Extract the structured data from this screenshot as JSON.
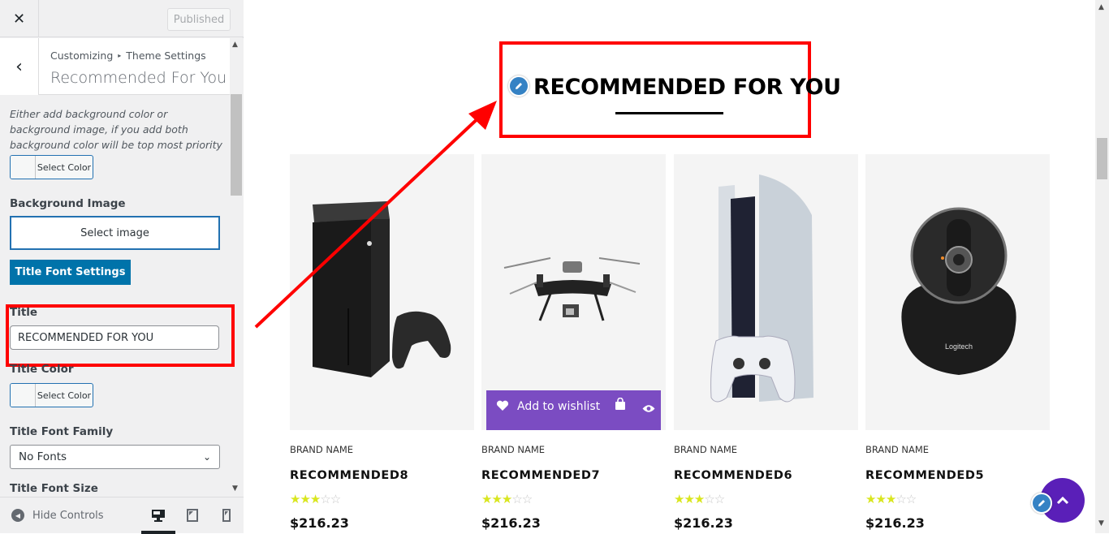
{
  "sidebar": {
    "close_icon": "close-icon",
    "publish_label": "Published",
    "breadcrumb": [
      "Customizing",
      "Theme Settings"
    ],
    "breadcrumb_sep": "▸",
    "section_title": "Recommended For You",
    "help_text": "Either add background color or background image, if you add both background color will be top most priority",
    "bg_color_label": "Select Color",
    "bg_image_label": "Background Image",
    "select_image_label": "Select image",
    "title_font_settings_label": "Title Font Settings",
    "title_label": "Title",
    "title_value": "RECOMMENDED FOR YOU",
    "title_color_label": "Title Color",
    "title_color_btn": "Select Color",
    "font_family_label": "Title Font Family",
    "font_family_value": "No Fonts",
    "font_size_label": "Title Font Size",
    "hide_controls_label": "Hide Controls",
    "devices": [
      "desktop",
      "tablet",
      "mobile"
    ],
    "active_device": "desktop"
  },
  "preview": {
    "heading": "RECOMMENDED FOR YOU",
    "products": [
      {
        "brand": "BRAND NAME",
        "name": "RECOMMENDED8",
        "rating": 3,
        "max_rating": 5,
        "price": "$216.23",
        "image": "xbox-console"
      },
      {
        "brand": "BRAND NAME",
        "name": "RECOMMENDED7",
        "rating": 3,
        "max_rating": 5,
        "price": "$216.23",
        "image": "drone",
        "hover": true
      },
      {
        "brand": "BRAND NAME",
        "name": "RECOMMENDED6",
        "rating": 3,
        "max_rating": 5,
        "price": "$216.23",
        "image": "playstation-console"
      },
      {
        "brand": "BRAND NAME",
        "name": "RECOMMENDED5",
        "rating": 3,
        "max_rating": 5,
        "price": "$216.23",
        "image": "logitech-webcam"
      }
    ],
    "hover_actions": {
      "wishlist": "Add to wishlist"
    },
    "colors": {
      "accent": "#7b4cc2",
      "star": "#d9e61f",
      "annotation": "#ff0000",
      "wp_blue": "#0073aa",
      "scroll_top": "#5a1fb8"
    }
  }
}
